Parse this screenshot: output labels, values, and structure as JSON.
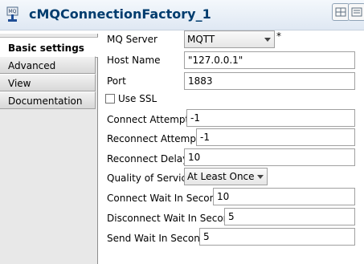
{
  "window": {
    "title": "cMQConnectionFactory_1",
    "icon_label": "MQ"
  },
  "tabs": [
    {
      "label": "Basic settings",
      "active": true
    },
    {
      "label": "Advanced settings",
      "active": false
    },
    {
      "label": "View",
      "active": false
    },
    {
      "label": "Documentation",
      "active": false
    }
  ],
  "form": {
    "mq_server": {
      "label": "MQ Server",
      "value": "MQTT",
      "required_mark": "*"
    },
    "host_name": {
      "label": "Host Name",
      "value": "\"127.0.0.1\""
    },
    "port": {
      "label": "Port",
      "value": "1883"
    },
    "use_ssl": {
      "label": "Use SSL",
      "checked": false
    },
    "connect_attempts": {
      "label": "Connect Attempts",
      "value": "-1"
    },
    "reconnect_attempts": {
      "label": "Reconnect Attempts",
      "value": "-1"
    },
    "reconnect_delay": {
      "label": "Reconnect Delay",
      "value": "10"
    },
    "quality_of_service": {
      "label": "Quality of Service",
      "value": "At Least Once"
    },
    "connect_wait": {
      "label": "Connect Wait In Seconds",
      "value": "10"
    },
    "disconnect_wait": {
      "label": "Disconnect Wait In Seconds",
      "value": "5"
    },
    "send_wait": {
      "label": "Send Wait In Seconds",
      "value": "5"
    }
  },
  "colors": {
    "title": "#003c6e",
    "tab_bg": "#e8e8e8",
    "border": "#a0a0a0"
  }
}
